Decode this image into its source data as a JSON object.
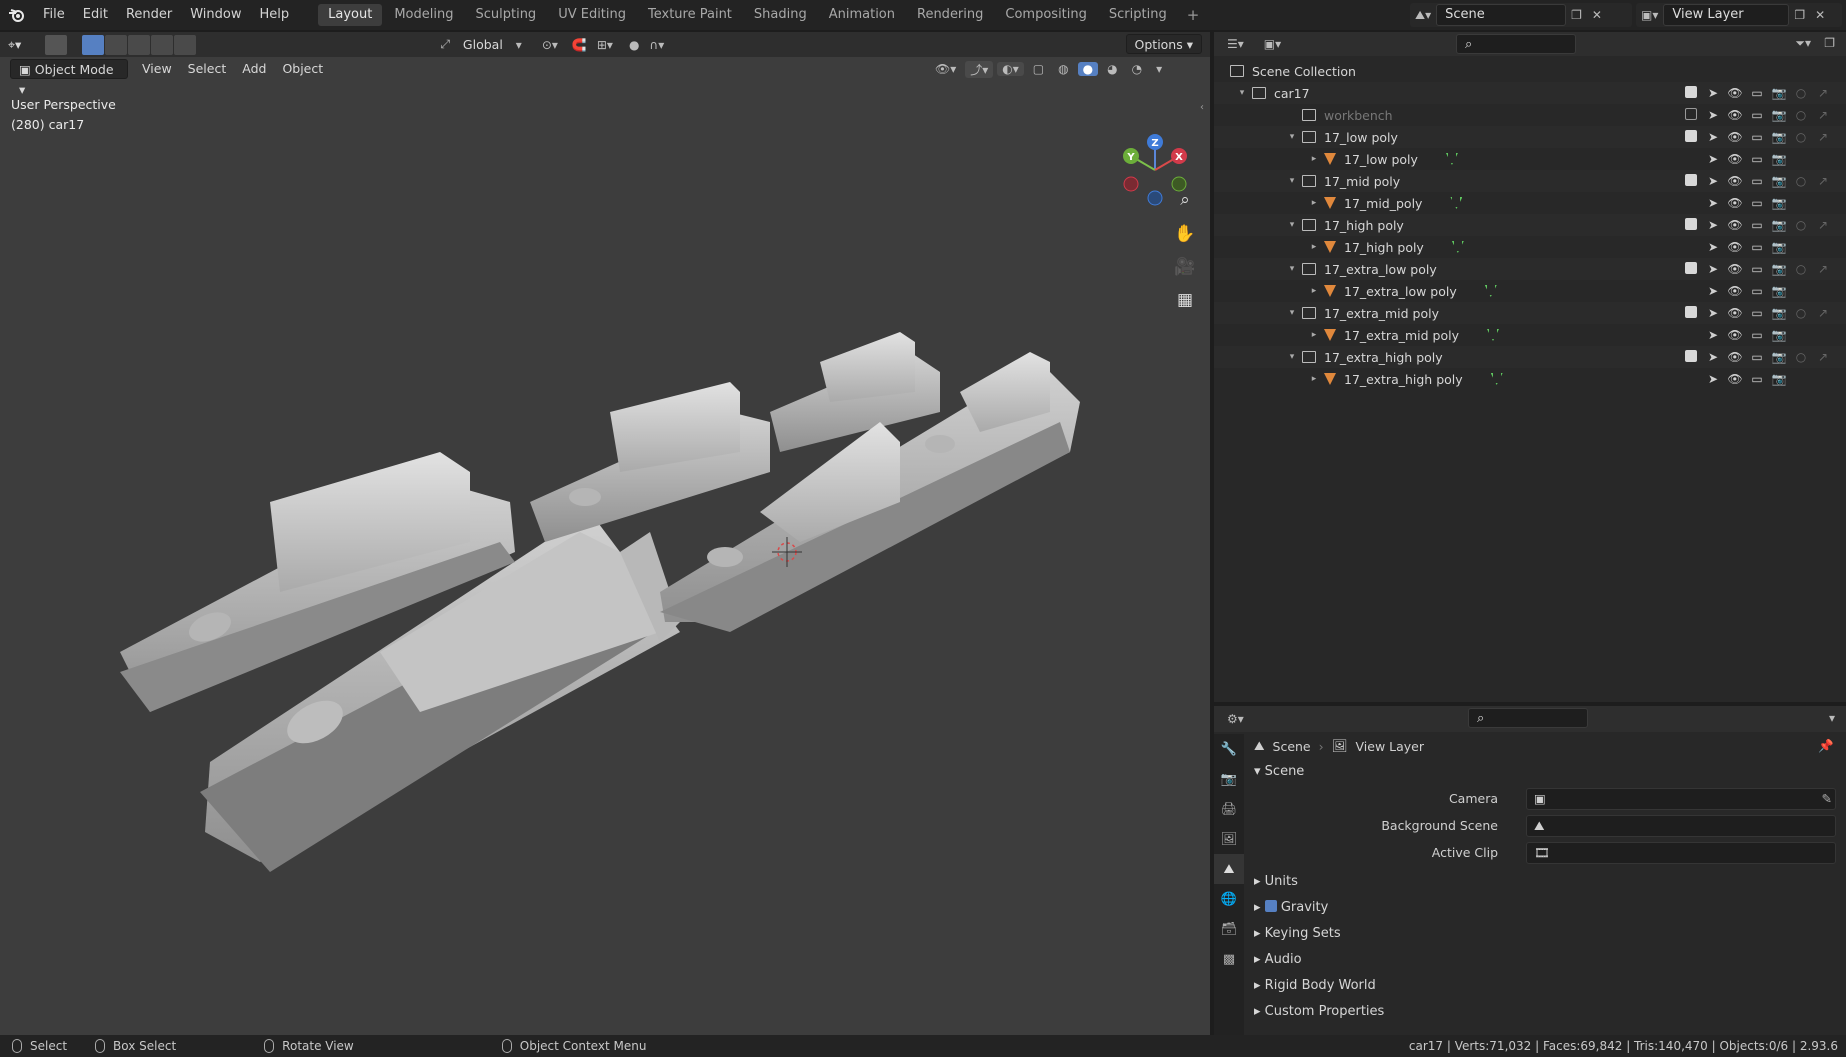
{
  "menu": {
    "file": "File",
    "edit": "Edit",
    "render": "Render",
    "window": "Window",
    "help": "Help"
  },
  "workspaces": [
    "Layout",
    "Modeling",
    "Sculpting",
    "UV Editing",
    "Texture Paint",
    "Shading",
    "Animation",
    "Rendering",
    "Compositing",
    "Scripting"
  ],
  "scene_field": "Scene",
  "view_layer_field": "View Layer",
  "viewport": {
    "transform_orientation": "Global",
    "options_label": "Options",
    "mode": "Object Mode",
    "menus": [
      "View",
      "Select",
      "Add",
      "Object"
    ],
    "perspective": "User Perspective",
    "frame_object": "(280) car17",
    "gizmo": {
      "x": "X",
      "y": "Y",
      "z": "Z"
    }
  },
  "outliner": {
    "scene_collection": "Scene Collection",
    "rows": [
      {
        "label": "car17",
        "kind": "collection",
        "level": 0
      },
      {
        "label": "workbench",
        "kind": "collection",
        "level": 1,
        "dim": true
      },
      {
        "label": "17_low poly",
        "kind": "collection",
        "level": 1
      },
      {
        "label": "17_low poly",
        "kind": "mesh",
        "level": 2
      },
      {
        "label": "17_mid poly",
        "kind": "collection",
        "level": 1
      },
      {
        "label": "17_mid_poly",
        "kind": "mesh",
        "level": 2
      },
      {
        "label": "17_high poly",
        "kind": "collection",
        "level": 1
      },
      {
        "label": "17_high poly",
        "kind": "mesh",
        "level": 2
      },
      {
        "label": "17_extra_low poly",
        "kind": "collection",
        "level": 1
      },
      {
        "label": "17_extra_low poly",
        "kind": "mesh",
        "level": 2
      },
      {
        "label": "17_extra_mid poly",
        "kind": "collection",
        "level": 1
      },
      {
        "label": "17_extra_mid poly",
        "kind": "mesh",
        "level": 2
      },
      {
        "label": "17_extra_high poly",
        "kind": "collection",
        "level": 1
      },
      {
        "label": "17_extra_high poly",
        "kind": "mesh",
        "level": 2
      }
    ]
  },
  "properties": {
    "breadcrumb_scene": "Scene",
    "breadcrumb_view_layer": "View Layer",
    "section_scene": "Scene",
    "camera_label": "Camera",
    "background_scene_label": "Background Scene",
    "active_clip_label": "Active Clip",
    "sections": [
      "Units",
      "Gravity",
      "Keying Sets",
      "Audio",
      "Rigid Body World",
      "Custom Properties"
    ]
  },
  "status": {
    "select": "Select",
    "box_select": "Box Select",
    "rotate_view": "Rotate View",
    "context_menu": "Object Context Menu",
    "stats": "car17 | Verts:71,032 | Faces:69,842 | Tris:140,470 | Objects:0/6 | 2.93.6"
  },
  "colors": {
    "accent": "#5680c2",
    "mesh_icon": "#e0883c",
    "data_icon": "#5fc65f",
    "viewport_bg": "#3d3d3d"
  }
}
